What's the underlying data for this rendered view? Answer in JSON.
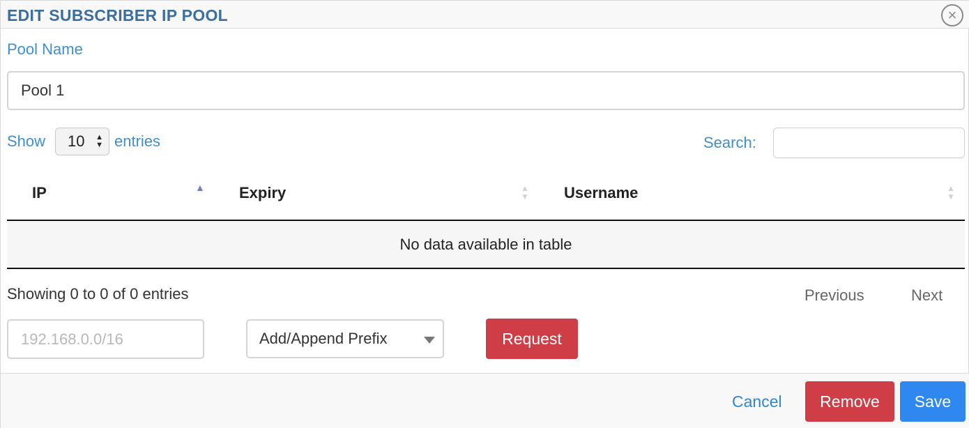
{
  "modal": {
    "title": "EDIT SUBSCRIBER IP POOL",
    "close_icon": "close-circle-icon"
  },
  "pool": {
    "label": "Pool Name",
    "value": "Pool 1"
  },
  "table_controls": {
    "show_label": "Show",
    "entries_value": "10",
    "entries_label": "entries",
    "search_label": "Search:",
    "search_value": ""
  },
  "table": {
    "columns": [
      {
        "label": "IP",
        "sort": "ascending"
      },
      {
        "label": "Expiry",
        "sort": "none"
      },
      {
        "label": "Username",
        "sort": "none"
      }
    ],
    "empty_message": "No data available in table"
  },
  "pagination": {
    "info": "Showing 0 to 0 of 0 entries",
    "previous": "Previous",
    "next": "Next"
  },
  "prefix": {
    "placeholder": "192.168.0.0/16",
    "select_value": "Add/Append Prefix",
    "request_label": "Request"
  },
  "footer": {
    "cancel_label": "Cancel",
    "remove_label": "Remove",
    "save_label": "Save"
  },
  "colors": {
    "title": "#3c6ea0",
    "label": "#3f8fd0",
    "danger": "#cf3d47",
    "primary": "#2f88f0",
    "link": "#2f86d6"
  }
}
